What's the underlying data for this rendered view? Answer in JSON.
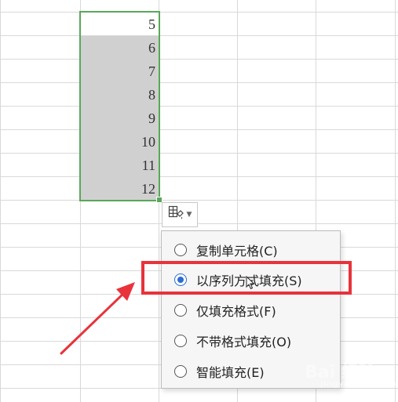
{
  "cells": [
    "5",
    "6",
    "7",
    "8",
    "9",
    "10",
    "11",
    "12"
  ],
  "autofill_menu": {
    "options": [
      {
        "label": "复制单元格(C)",
        "selected": false
      },
      {
        "label": "以序列方式填充(S)",
        "selected": true
      },
      {
        "label": "仅填充格式(F)",
        "selected": false
      },
      {
        "label": "不带格式填充(O)",
        "selected": false
      },
      {
        "label": "智能填充(E)",
        "selected": false
      }
    ]
  },
  "icons": {
    "autofill": "autofill-options-icon",
    "caret": "chevron-down-icon"
  },
  "colors": {
    "selection_border": "#5aa75a",
    "selected_fill": "#d0d0d0",
    "radio_accent": "#2b6cd6",
    "highlight": "#e8333b"
  },
  "watermark": {
    "brand": "Bai 经验",
    "sub": "jingyan.baidu.com"
  }
}
